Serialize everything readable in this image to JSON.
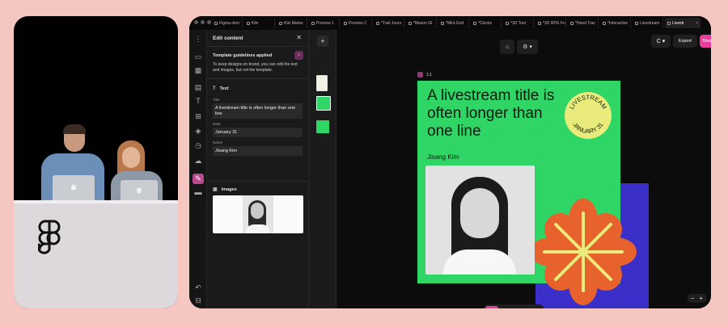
{
  "browser": {
    "tabs": [
      {
        "label": "Figma dem"
      },
      {
        "label": "Kiln"
      },
      {
        "label": "Kiln Marke"
      },
      {
        "label": "Preview 1"
      },
      {
        "label": "Preview 2"
      },
      {
        "label": "*Trail Journ"
      },
      {
        "label": "*Mason Gl"
      },
      {
        "label": "*Mini-Grid"
      },
      {
        "label": "*Clocks"
      },
      {
        "label": "*3D Tool"
      },
      {
        "label": "*3D RPG Fo"
      },
      {
        "label": "*Hand Trac"
      },
      {
        "label": "*Interactive"
      },
      {
        "label": "Livestream"
      },
      {
        "label": "Livestr"
      }
    ],
    "active_tab": "Livestr"
  },
  "edit_panel": {
    "title": "Edit content",
    "guidelines": {
      "title": "Template guidelines applied",
      "body": "To keep designs on brand, you can edit the text and images, but not the template."
    },
    "text_section": "Text",
    "fields": [
      {
        "label": "Title",
        "value": "A livestream title is often longer than one line"
      },
      {
        "label": "Date",
        "value": "January 31"
      },
      {
        "label": "Name",
        "value": "Jisang Kim"
      }
    ],
    "images_section": "Images"
  },
  "canvas": {
    "frame_label": "1:1",
    "export_label": "Export",
    "share_label": "Shar",
    "avatar_letter": "C",
    "poster": {
      "title": "A livestream title is often longer than one line",
      "author": "Jisang Kim",
      "badge_top": "LIVESTREAM",
      "badge_bottom": "JANUARY 31"
    }
  },
  "colors": {
    "background": "#f6c6c0",
    "poster_green": "#2fd565",
    "badge_yellow": "#e9ec7b",
    "accent_pink": "#e93d9b",
    "flower_orange": "#e8622d",
    "blue_block": "#3a2fc8"
  }
}
